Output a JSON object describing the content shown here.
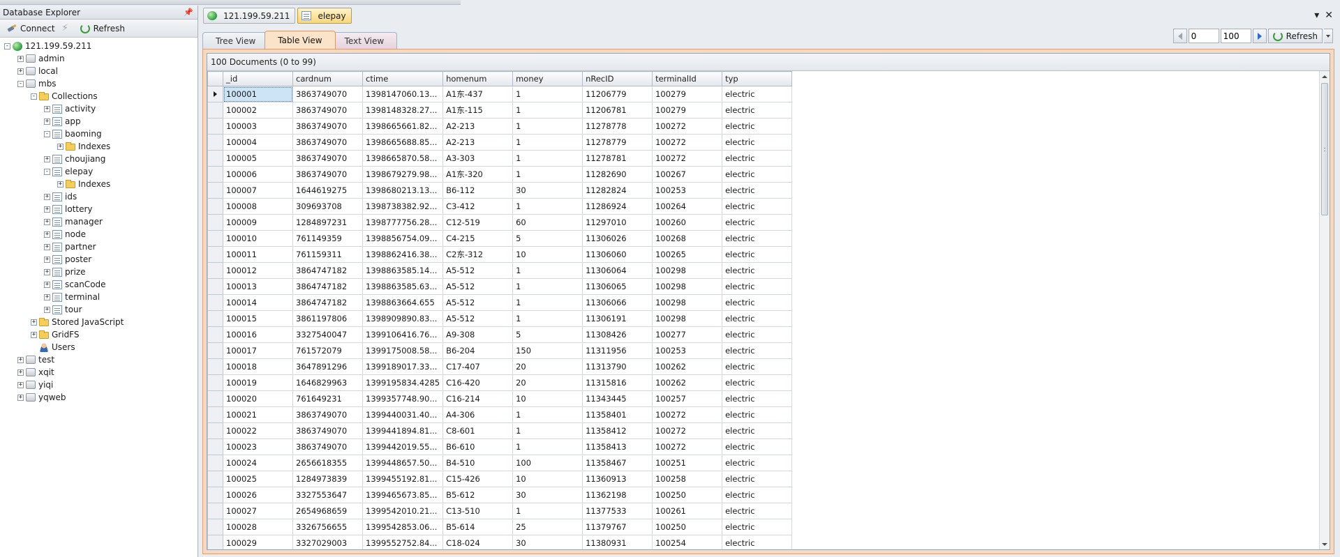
{
  "explorer": {
    "title": "Database Explorer",
    "connect_label": "Connect",
    "refresh_label": "Refresh"
  },
  "tree": [
    {
      "label": "121.199.59.211",
      "depth": 0,
      "icon": "server",
      "exp": "-"
    },
    {
      "label": "admin",
      "depth": 1,
      "icon": "db",
      "exp": "+"
    },
    {
      "label": "local",
      "depth": 1,
      "icon": "db",
      "exp": "+"
    },
    {
      "label": "mbs",
      "depth": 1,
      "icon": "db",
      "exp": "-"
    },
    {
      "label": "Collections",
      "depth": 2,
      "icon": "folder",
      "exp": "-"
    },
    {
      "label": "activity",
      "depth": 3,
      "icon": "coll",
      "exp": "+"
    },
    {
      "label": "app",
      "depth": 3,
      "icon": "coll",
      "exp": "+"
    },
    {
      "label": "baoming",
      "depth": 3,
      "icon": "coll",
      "exp": "-"
    },
    {
      "label": "Indexes",
      "depth": 4,
      "icon": "folder",
      "exp": "+"
    },
    {
      "label": "choujiang",
      "depth": 3,
      "icon": "coll",
      "exp": "+"
    },
    {
      "label": "elepay",
      "depth": 3,
      "icon": "coll",
      "exp": "-"
    },
    {
      "label": "Indexes",
      "depth": 4,
      "icon": "folder",
      "exp": "+"
    },
    {
      "label": "ids",
      "depth": 3,
      "icon": "coll",
      "exp": "+"
    },
    {
      "label": "lottery",
      "depth": 3,
      "icon": "coll",
      "exp": "+"
    },
    {
      "label": "manager",
      "depth": 3,
      "icon": "coll",
      "exp": "+"
    },
    {
      "label": "node",
      "depth": 3,
      "icon": "coll",
      "exp": "+"
    },
    {
      "label": "partner",
      "depth": 3,
      "icon": "coll",
      "exp": "+"
    },
    {
      "label": "poster",
      "depth": 3,
      "icon": "coll",
      "exp": "+"
    },
    {
      "label": "prize",
      "depth": 3,
      "icon": "coll",
      "exp": "+"
    },
    {
      "label": "scanCode",
      "depth": 3,
      "icon": "coll",
      "exp": "+"
    },
    {
      "label": "terminal",
      "depth": 3,
      "icon": "coll",
      "exp": "+"
    },
    {
      "label": "tour",
      "depth": 3,
      "icon": "coll",
      "exp": "+"
    },
    {
      "label": "Stored JavaScript",
      "depth": 2,
      "icon": "folder",
      "exp": "+"
    },
    {
      "label": "GridFS",
      "depth": 2,
      "icon": "folder",
      "exp": "+"
    },
    {
      "label": "Users",
      "depth": 2,
      "icon": "user",
      "exp": ""
    },
    {
      "label": "test",
      "depth": 1,
      "icon": "db",
      "exp": "+"
    },
    {
      "label": "xqit",
      "depth": 1,
      "icon": "db",
      "exp": "+"
    },
    {
      "label": "yiqi",
      "depth": 1,
      "icon": "db",
      "exp": "+"
    },
    {
      "label": "yqweb",
      "depth": 1,
      "icon": "db",
      "exp": "+"
    }
  ],
  "doc_tabs": [
    {
      "label": "121.199.59.211",
      "icon": "server"
    },
    {
      "label": "elepay",
      "icon": "table"
    }
  ],
  "view_tabs": [
    "Tree View",
    "Table View",
    "Text View"
  ],
  "pager": {
    "from": "0",
    "count": "100",
    "refresh_label": "Refresh"
  },
  "doc_count": "100 Documents (0 to 99)",
  "columns": [
    "_id",
    "cardnum",
    "ctime",
    "homenum",
    "money",
    "nRecID",
    "terminalId",
    "typ"
  ],
  "rows": [
    [
      "100001",
      "3863749070",
      "1398147060.13...",
      "A1东-437",
      "1",
      "11206779",
      "100279",
      "electric"
    ],
    [
      "100002",
      "3863749070",
      "1398148328.27...",
      "A1东-115",
      "1",
      "11206781",
      "100279",
      "electric"
    ],
    [
      "100003",
      "3863749070",
      "1398665661.82...",
      "A2-213",
      "1",
      "11278778",
      "100272",
      "electric"
    ],
    [
      "100004",
      "3863749070",
      "1398665688.85...",
      "A2-213",
      "1",
      "11278779",
      "100272",
      "electric"
    ],
    [
      "100005",
      "3863749070",
      "1398665870.58...",
      "A3-303",
      "1",
      "11278781",
      "100272",
      "electric"
    ],
    [
      "100006",
      "3863749070",
      "1398679279.98...",
      "A1东-320",
      "1",
      "11282690",
      "100267",
      "electric"
    ],
    [
      "100007",
      "1644619275",
      "1398680213.13...",
      "B6-112",
      "30",
      "11282824",
      "100253",
      "electric"
    ],
    [
      "100008",
      "309693708",
      "1398738382.92...",
      "C3-412",
      "1",
      "11286924",
      "100264",
      "electric"
    ],
    [
      "100009",
      "1284897231",
      "1398777756.28...",
      "C12-519",
      "60",
      "11297010",
      "100260",
      "electric"
    ],
    [
      "100010",
      "761149359",
      "1398856754.09...",
      "C4-215",
      "5",
      "11306026",
      "100268",
      "electric"
    ],
    [
      "100011",
      "761159311",
      "1398862416.38...",
      "C2东-312",
      "10",
      "11306060",
      "100265",
      "electric"
    ],
    [
      "100012",
      "3864747182",
      "1398863585.14...",
      "A5-512",
      "1",
      "11306064",
      "100298",
      "electric"
    ],
    [
      "100013",
      "3864747182",
      "1398863585.63...",
      "A5-512",
      "1",
      "11306065",
      "100298",
      "electric"
    ],
    [
      "100014",
      "3864747182",
      "1398863664.655",
      "A5-512",
      "1",
      "11306066",
      "100298",
      "electric"
    ],
    [
      "100015",
      "3861197806",
      "1398909890.83...",
      "A5-512",
      "1",
      "11306191",
      "100298",
      "electric"
    ],
    [
      "100016",
      "3327540047",
      "1399106416.76...",
      "A9-308",
      "5",
      "11308426",
      "100277",
      "electric"
    ],
    [
      "100017",
      "761572079",
      "1399175008.58...",
      "B6-204",
      "150",
      "11311956",
      "100253",
      "electric"
    ],
    [
      "100018",
      "3647891296",
      "1399189017.33...",
      "C17-407",
      "20",
      "11313790",
      "100262",
      "electric"
    ],
    [
      "100019",
      "1646829963",
      "1399195834.4285",
      "C16-420",
      "20",
      "11315816",
      "100262",
      "electric"
    ],
    [
      "100020",
      "761649231",
      "1399357748.90...",
      "C16-214",
      "10",
      "11343445",
      "100257",
      "electric"
    ],
    [
      "100021",
      "3863749070",
      "1399440031.40...",
      "A4-306",
      "1",
      "11358401",
      "100272",
      "electric"
    ],
    [
      "100022",
      "3863749070",
      "1399441894.81...",
      "C8-601",
      "1",
      "11358412",
      "100272",
      "electric"
    ],
    [
      "100023",
      "3863749070",
      "1399442019.55...",
      "B6-610",
      "1",
      "11358413",
      "100272",
      "electric"
    ],
    [
      "100024",
      "2656618355",
      "1399448657.50...",
      "B4-510",
      "100",
      "11358467",
      "100251",
      "electric"
    ],
    [
      "100025",
      "1284973839",
      "1399455192.81...",
      "C15-426",
      "10",
      "11360913",
      "100258",
      "electric"
    ],
    [
      "100026",
      "3327553647",
      "1399465673.85...",
      "B5-612",
      "30",
      "11362198",
      "100250",
      "electric"
    ],
    [
      "100027",
      "2654968659",
      "1399542010.21...",
      "C13-510",
      "1",
      "11377533",
      "100261",
      "electric"
    ],
    [
      "100028",
      "3326756655",
      "1399542853.06...",
      "B5-614",
      "25",
      "11379767",
      "100250",
      "electric"
    ],
    [
      "100029",
      "3327029003",
      "1399552752.84...",
      "C18-024",
      "30",
      "11380931",
      "100254",
      "electric"
    ]
  ],
  "colors": {
    "accent_tab": "#f8d77a",
    "selection": "#cde4f7",
    "content_border": "#f7d9bf"
  }
}
